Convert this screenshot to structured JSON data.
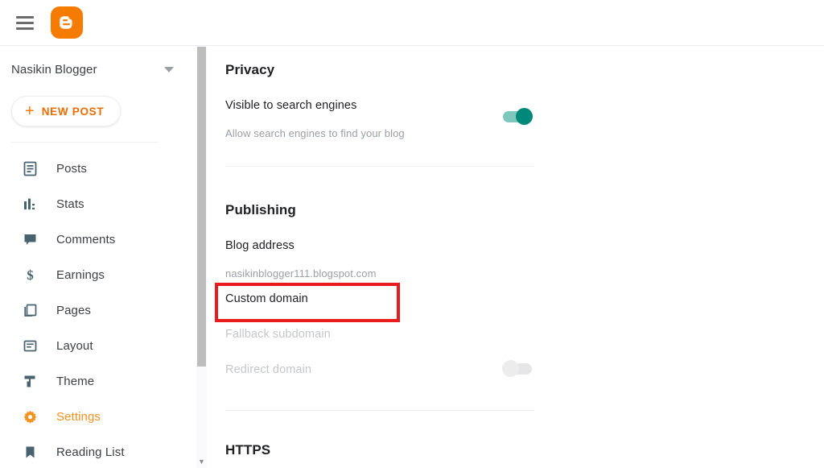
{
  "header": {
    "menu_icon": "hamburger-menu-icon",
    "logo_icon": "blogger-logo-icon"
  },
  "sidebar": {
    "blog_name": "Nasikin Blogger",
    "dropdown_icon": "chevron-down-icon",
    "new_post": {
      "plus": "+",
      "label": "NEW POST"
    },
    "items": [
      {
        "label": "Posts",
        "icon": "posts-icon",
        "active": false
      },
      {
        "label": "Stats",
        "icon": "stats-icon",
        "active": false
      },
      {
        "label": "Comments",
        "icon": "comments-icon",
        "active": false
      },
      {
        "label": "Earnings",
        "icon": "earnings-icon",
        "active": false
      },
      {
        "label": "Pages",
        "icon": "pages-icon",
        "active": false
      },
      {
        "label": "Layout",
        "icon": "layout-icon",
        "active": false
      },
      {
        "label": "Theme",
        "icon": "theme-icon",
        "active": false
      },
      {
        "label": "Settings",
        "icon": "settings-gear-icon",
        "active": true
      },
      {
        "label": "Reading List",
        "icon": "reading-list-icon",
        "active": false
      }
    ]
  },
  "scrollbar": {
    "down_arrow_icon": "scroll-down-arrow-icon"
  },
  "main": {
    "privacy": {
      "title": "Privacy",
      "visible_to_search_engines": {
        "label": "Visible to search engines",
        "sub": "Allow search engines to find your blog",
        "toggle_state": "on"
      }
    },
    "publishing": {
      "title": "Publishing",
      "blog_address": {
        "label": "Blog address",
        "value": "nasikinblogger111.blogspot.com"
      },
      "custom_domain": {
        "label": "Custom domain",
        "highlighted": true
      },
      "fallback_subdomain": {
        "label": "Fallback subdomain",
        "disabled": true
      },
      "redirect_domain": {
        "label": "Redirect domain",
        "disabled": true,
        "toggle_state": "off"
      }
    },
    "https": {
      "title": "HTTPS"
    }
  },
  "colors": {
    "brand_orange": "#f57c00",
    "active_orange": "#f29221",
    "toggle_on": "#00897b",
    "toggle_on_track": "#7fc7bd",
    "annotation_red": "#e81c1c",
    "icon_slate": "#49626f"
  }
}
